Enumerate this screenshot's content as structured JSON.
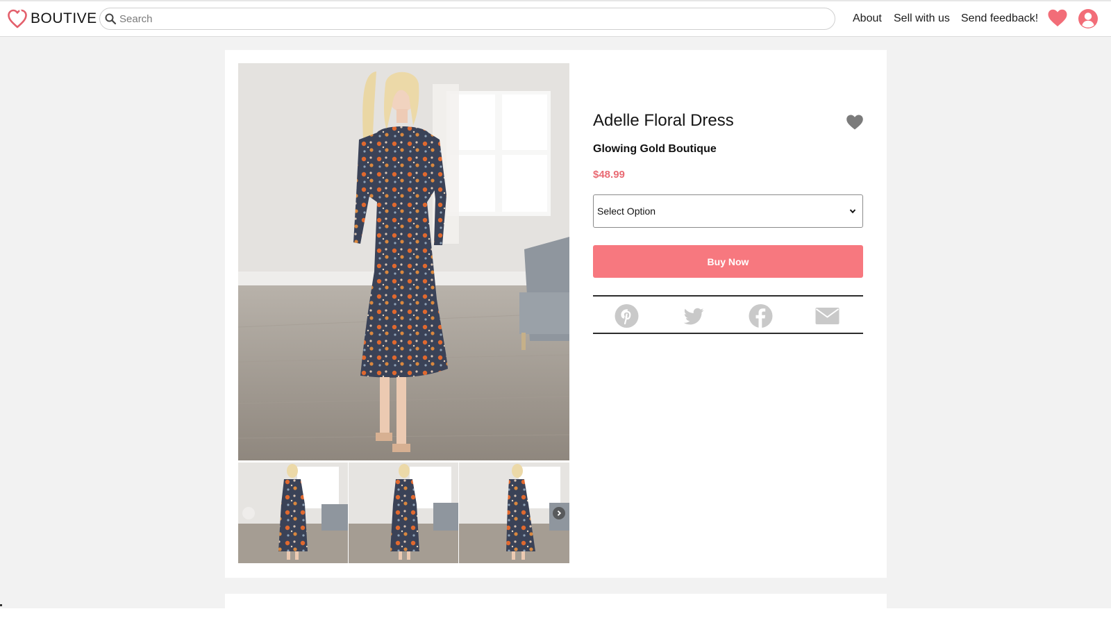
{
  "header": {
    "logo_text": "BOUTIVE",
    "logo_icon": "heart-outline-icon",
    "search_placeholder": "Search",
    "nav_about": "About",
    "nav_sell": "Sell with us",
    "nav_feedback": "Send feedback!",
    "favorites_icon": "heart-icon",
    "account_icon": "user-circle-icon"
  },
  "product": {
    "title": "Adelle Floral Dress",
    "shop": "Glowing Gold Boutique",
    "price": "$48.99",
    "option_selected": "Select Option",
    "buy_label": "Buy Now",
    "favorite_icon": "heart-icon",
    "main_image_alt": "Woman in floral midi dress standing in a bright room",
    "thumbnails": [
      {
        "alt": "Front view of floral dress"
      },
      {
        "alt": "Front view with hands in pockets"
      },
      {
        "alt": "Side view of floral dress"
      }
    ]
  },
  "share": {
    "icons": [
      "pinterest-icon",
      "twitter-icon",
      "facebook-icon",
      "email-icon"
    ]
  },
  "colors": {
    "accent": "#f7787f",
    "price": "#e96b74",
    "logo": "#e35f6b",
    "share_icons": "#c9c9c9",
    "fav_heart": "#7b7b7b"
  }
}
